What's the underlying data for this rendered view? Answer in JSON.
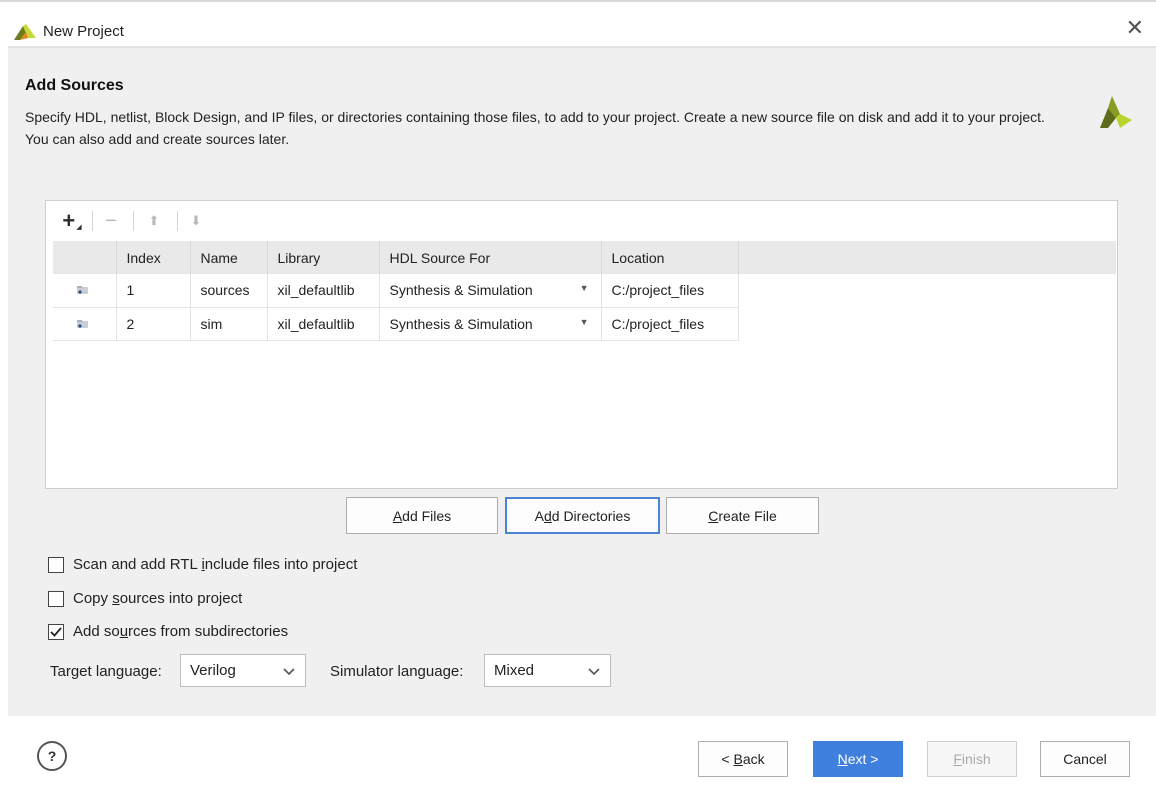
{
  "window": {
    "title": "New Project",
    "close_label": "✕"
  },
  "header": {
    "title": "Add Sources",
    "description": "Specify HDL, netlist, Block Design, and IP files, or directories containing those files, to add to your project. Create a new source file on disk and add it to your project. You can also add and create sources later."
  },
  "toolbar": {
    "add": "+",
    "remove": "−",
    "up": "⬆",
    "down": "⬇"
  },
  "table": {
    "columns": [
      "Index",
      "Name",
      "Library",
      "HDL Source For",
      "Location"
    ],
    "rows": [
      {
        "index": "1",
        "name": "sources",
        "library": "xil_defaultlib",
        "hdl_source_for": "Synthesis & Simulation",
        "location": "C:/project_files"
      },
      {
        "index": "2",
        "name": "sim",
        "library": "xil_defaultlib",
        "hdl_source_for": "Synthesis & Simulation",
        "location": "C:/project_files"
      }
    ]
  },
  "actions": {
    "add_files": {
      "mnemonic": "A",
      "rest": "dd Files"
    },
    "add_directories": {
      "prefix": "A",
      "mnemonic": "d",
      "rest": "d Directories"
    },
    "create_file": {
      "mnemonic": "C",
      "rest": "reate File"
    }
  },
  "options": {
    "scan_rtl": {
      "prefix": "Scan and add RTL ",
      "mnemonic": "i",
      "rest": "nclude files into project",
      "checked": false
    },
    "copy_sources": {
      "prefix": "Copy ",
      "mnemonic": "s",
      "rest": "ources into project",
      "checked": false
    },
    "subdirectories": {
      "prefix": "Add so",
      "mnemonic": "u",
      "rest": "rces from subdirectories",
      "checked": true
    }
  },
  "language": {
    "target_label": "Target language:",
    "target_value": "Verilog",
    "simulator_label": "Simulator language:",
    "simulator_value": "Mixed"
  },
  "footer": {
    "help": "?",
    "back": {
      "prefix": "< ",
      "mnemonic": "B",
      "rest": "ack"
    },
    "next": {
      "mnemonic": "N",
      "rest": "ext >"
    },
    "finish": {
      "mnemonic": "F",
      "rest": "inish"
    },
    "cancel": "Cancel"
  },
  "colors": {
    "primary_button": "#3f7fde",
    "focus_border": "#4a83d4",
    "content_bg": "#f0f0f0",
    "logo_dark": "#5d6b1a",
    "logo_light": "#b7d52c"
  }
}
